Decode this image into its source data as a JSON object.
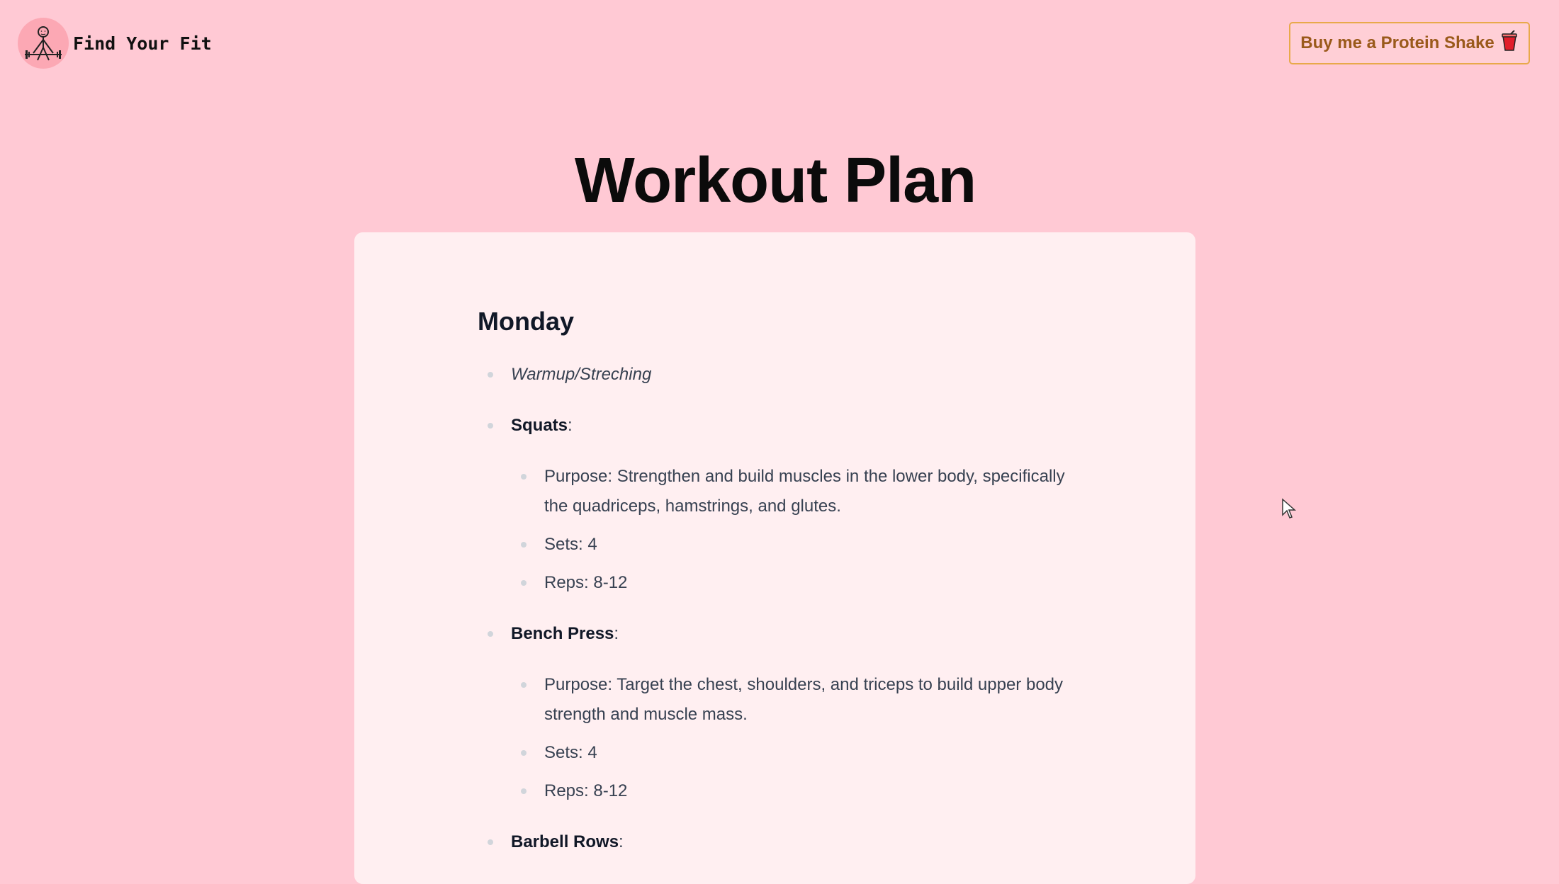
{
  "header": {
    "brand_name": "Find Your Fit",
    "logo_icon": "weightlifter-icon",
    "shake_button_label": "Buy me a Protein Shake",
    "shake_button_icon": "cup-icon"
  },
  "page": {
    "title": "Workout Plan"
  },
  "plan": {
    "day": "Monday",
    "items": [
      {
        "label": "Warmup/Streching"
      },
      {
        "label": "Squats",
        "suffix": ":",
        "details": [
          "Purpose: Strengthen and build muscles in the lower body, specifically the quadriceps, hamstrings, and glutes.",
          "Sets: 4",
          "Reps: 8-12"
        ]
      },
      {
        "label": "Bench Press",
        "suffix": ":",
        "details": [
          "Purpose: Target the chest, shoulders, and triceps to build upper body strength and muscle mass.",
          "Sets: 4",
          "Reps: 8-12"
        ]
      },
      {
        "label": "Barbell Rows",
        "suffix": ":"
      }
    ]
  },
  "colors": {
    "background": "#ffc9d4",
    "card": "#ffeff1",
    "button_border": "#e8a94a",
    "button_text": "#9a5a1b"
  }
}
